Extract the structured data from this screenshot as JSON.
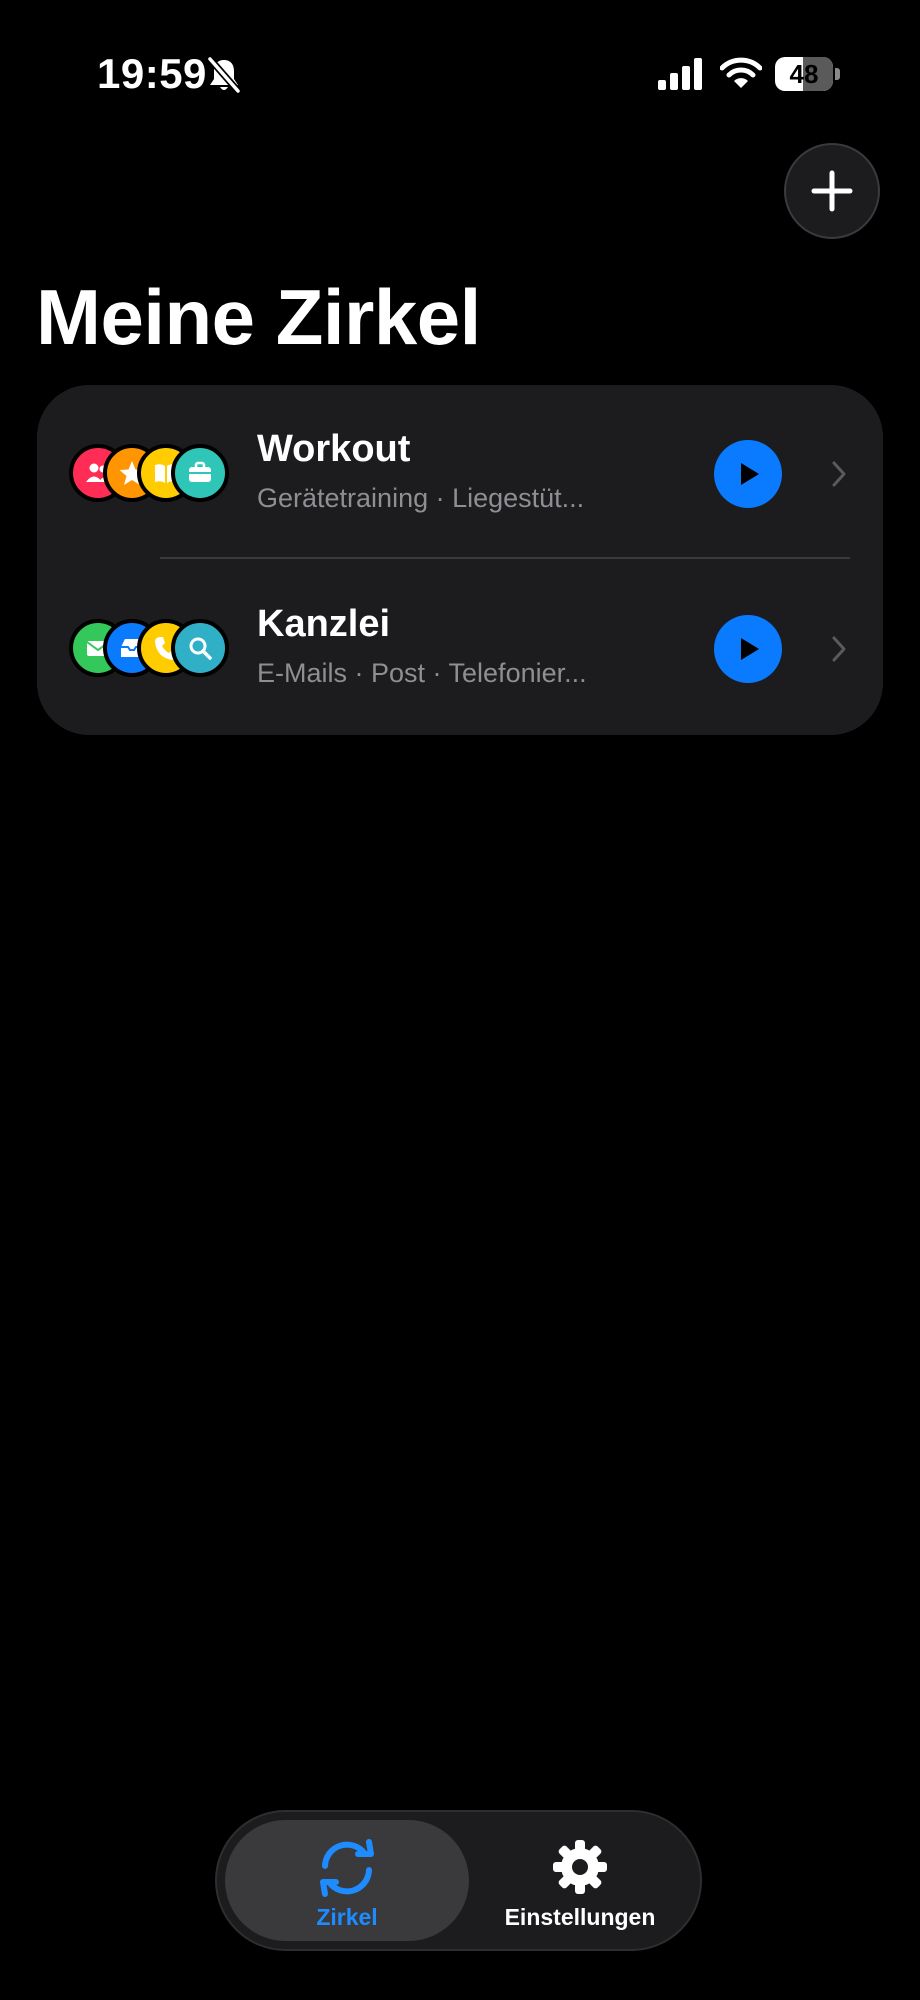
{
  "status_bar": {
    "time": "19:59",
    "battery_level": "48",
    "battery_fraction": 0.48,
    "icons": [
      "bell-slash-icon",
      "cellular-signal-icon",
      "wifi-icon",
      "battery-icon"
    ]
  },
  "header": {
    "title": "Meine Zirkel",
    "add_icon": "plus-icon"
  },
  "circles": [
    {
      "title": "Workout",
      "subtitle": "Gerätetraining · Liegestüt...",
      "icons": [
        {
          "name": "people-icon",
          "color": "#ff2d55"
        },
        {
          "name": "star-icon",
          "color": "#ff9500"
        },
        {
          "name": "book-icon",
          "color": "#ffcc00"
        },
        {
          "name": "briefcase-icon",
          "color": "#30c6b7"
        }
      ],
      "play_icon": "play-icon",
      "chevron_icon": "chevron-right-icon"
    },
    {
      "title": "Kanzlei",
      "subtitle": "E-Mails · Post · Telefonier...",
      "icons": [
        {
          "name": "mail-icon",
          "color": "#34c759"
        },
        {
          "name": "tray-icon",
          "color": "#0a7aff"
        },
        {
          "name": "phone-icon",
          "color": "#ffcc00"
        },
        {
          "name": "magnifier-icon",
          "color": "#30b0c7"
        }
      ],
      "play_icon": "play-icon",
      "chevron_icon": "chevron-right-icon"
    }
  ],
  "tab_bar": {
    "tabs": [
      {
        "label": "Zirkel",
        "icon": "cycle-arrows-icon",
        "selected": true
      },
      {
        "label": "Einstellungen",
        "icon": "gear-icon",
        "selected": false
      }
    ]
  },
  "colors": {
    "accent": "#0a7aff",
    "background": "#000000",
    "card": "#1c1c1e",
    "secondary_text": "#8e8e93"
  }
}
